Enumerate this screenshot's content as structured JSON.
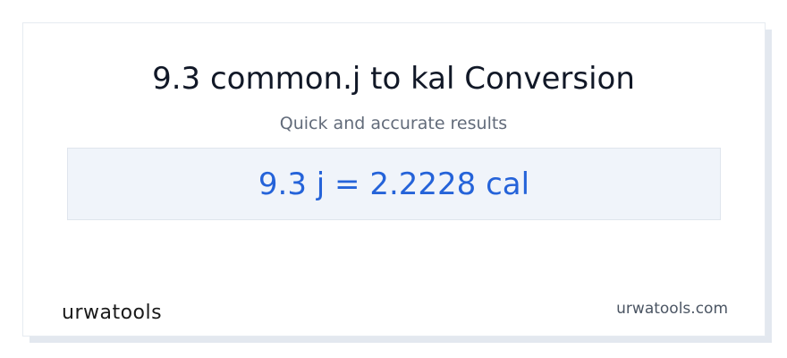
{
  "header": {
    "title": "9.3 common.j to kal Conversion",
    "subtitle": "Quick and accurate results"
  },
  "result": {
    "text": "9.3 j = 2.2228 cal"
  },
  "footer": {
    "logo_text": "urwatools",
    "site": "urwatools.com"
  },
  "colors": {
    "accent": "#2563d9",
    "result_bg": "#f0f4fa",
    "title": "#111827",
    "subtitle": "#626b7a"
  }
}
